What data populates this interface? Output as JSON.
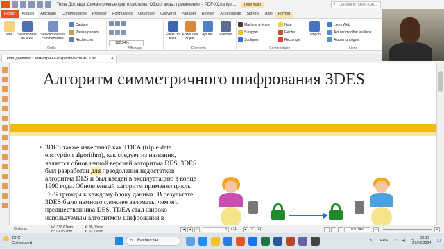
{
  "titlebar": {
    "doc_title": "Tema Доклада :Симметричные криптосистемы. Обзор, виды, применение. - PDF-XChange ...",
    "tool_tab": "Outil main",
    "search_placeholder": "Lancement rapide (Ctrl..."
  },
  "tabs": [
    {
      "label": "Fichier"
    },
    {
      "label": "Accueil"
    },
    {
      "label": "Affichage"
    },
    {
      "label": "Commentaires"
    },
    {
      "label": "Protéger"
    },
    {
      "label": "Formulaires"
    },
    {
      "label": "Organiser"
    },
    {
      "label": "Convertir"
    },
    {
      "label": "Partager"
    },
    {
      "label": "Réviser"
    },
    {
      "label": "Accessibilité"
    },
    {
      "label": "Signets"
    },
    {
      "label": "Aide"
    },
    {
      "label": "Format"
    }
  ],
  "ribbon": {
    "main": "Main",
    "select_text": "Sélectionner du texte",
    "select_comments": "Sélectionner les commentaires",
    "capture": "Capture",
    "clipboard": "Presse-papiers",
    "search": "Rechercher",
    "tools_group": "Outils",
    "zoom_value": "102,34%",
    "display_group": "Affichage",
    "edit_text": "Éditer un texte",
    "edit_objects": "Éditer des objets",
    "add": "Ajouter",
    "selection": "Sélection",
    "elements_group": "Éléments",
    "typewriter": "Machine à écrire",
    "note": "Note",
    "highlight": "Surligner",
    "arrow": "Flèche",
    "underline": "Souligner",
    "rectangle": "Rectangle",
    "stamp": "Tampon",
    "comment_group": "Commentaire",
    "web_links": "Liens Web",
    "add_edit_link": "Ajouter/modifier les liens",
    "add_bookmark": "Ajouter un signet",
    "links_group": "Liens"
  },
  "document": {
    "tab_title": "Tema Доклада :Симметричные криптосистемы. Обз...",
    "slide_title": "Алгоритм симметричного шифрования 3DES",
    "bullet_before_highlight": "3DES также известный как TDEA (triple data encryption algorithm), как следует из названия, является обновленной версией алгоритма DES. 3DES был разработан ",
    "bullet_highlight": "для",
    "bullet_after_highlight": " преодоления недостатков алгоритма DES и был введен в эксплуатацию в конце 1990 года. Обновленный алгоритм применял циклы DES трижды к каждому блоку данных. В результате 3DES было намного сложнее взломать, чем его предшественника DES. TDEA стал широко используемым алгоритмом шифрования в"
  },
  "statusbar": {
    "options": "Options...",
    "w": "W: 338,67mm",
    "h": "H: 190,50mm",
    "x": "X: 86,09mm",
    "y": "Y: 92,79mm",
    "page_current": "3",
    "page_total": "/ 11",
    "zoom": "102,34%"
  },
  "taskbar": {
    "temperature": "23°C",
    "weather": "Ciel couvert",
    "search": "Rechercher",
    "language": "FRA",
    "time": "00:17",
    "date": "27/08/2024"
  },
  "colors": {
    "brand_orange": "#e8541e",
    "slide_yellow": "#f5b80c",
    "lock_green": "#1f8a2c"
  }
}
